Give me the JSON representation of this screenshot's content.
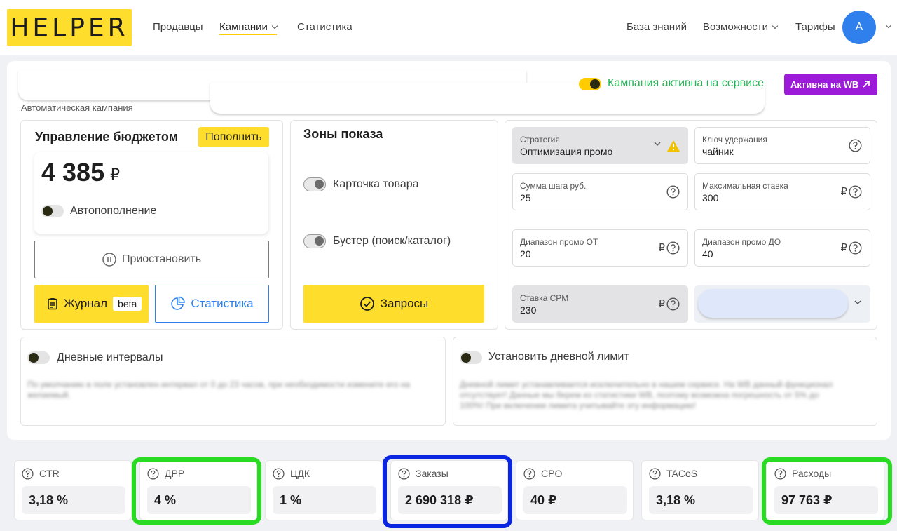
{
  "header": {
    "logo": "HELPER",
    "nav": {
      "sellers": "Продавцы",
      "campaigns": "Кампании",
      "statistics": "Статистика",
      "knowledge_base": "База знаний",
      "features": "Возможности",
      "tariffs": "Тарифы"
    },
    "avatar_letter": "A"
  },
  "campaign": {
    "type_label": "Автоматическая кампания",
    "active_on_service_text": "Кампания активна на сервисе",
    "active_on_wb_button": "Активна на WB"
  },
  "budget": {
    "title": "Управление бюджетом",
    "topup_button": "Пополнить",
    "balance": "4 385",
    "currency": "₽",
    "autofill_label": "Автопополнение",
    "pause_button": "Приостановить",
    "journal_button": "Журнал",
    "journal_badge": "beta",
    "stats_button": "Статистика"
  },
  "zones": {
    "title": "Зоны показа",
    "product_card": "Карточка товара",
    "booster": "Бустер (поиск/каталог)",
    "requests_button": "Запросы"
  },
  "strategy": {
    "strategy": {
      "label": "Стратегия",
      "value": "Оптимизация промо"
    },
    "retention_key": {
      "label": "Ключ удержания",
      "value": "чайник"
    },
    "step_sum": {
      "label": "Сумма шага руб.",
      "value": "25"
    },
    "max_bid": {
      "label": "Максимальная ставка",
      "value": "300",
      "unit": "₽"
    },
    "promo_from": {
      "label": "Диапазон промо ОТ",
      "value": "20",
      "unit": "₽"
    },
    "promo_to": {
      "label": "Диапазон промо ДО",
      "value": "40",
      "unit": "₽"
    },
    "cpm_bid": {
      "label": "Ставка CPM",
      "value": "230",
      "unit": "₽"
    }
  },
  "intervals": {
    "daily_intervals_label": "Дневные интервалы",
    "daily_intervals_desc": "По умолчанию в поле установлен интервал от 0 до 23 часов, при необходимости измените его на желаемый.",
    "daily_limit_label": "Установить дневной лимит",
    "daily_limit_desc": "Дневной лимит устанавливается исключительно в нашем сервисе. На WB данный функционал отсутствует! Данные мы берем из статистики WB, поэтому возможна погрешность от 5% до 100%! При включении лимита учитывайте эту информацию!"
  },
  "metrics": [
    {
      "label": "CTR",
      "value": "3,18 %"
    },
    {
      "label": "ДРР",
      "value": "4 %"
    },
    {
      "label": "ЦДК",
      "value": "1 %"
    },
    {
      "label": "Заказы",
      "value": "2 690 318 ₽"
    },
    {
      "label": "CPO",
      "value": "40 ₽"
    },
    {
      "label": "TACoS",
      "value": "3,18 %"
    },
    {
      "label": "Расходы",
      "value": "97 763 ₽"
    }
  ],
  "colors": {
    "brand_yellow": "#ffdd2d",
    "active_green": "#1fb554",
    "wb_purple": "#9b1bd9",
    "accent_blue": "#2f80ed",
    "highlight_green": "#2adb24",
    "highlight_blue": "#0b26e2"
  }
}
